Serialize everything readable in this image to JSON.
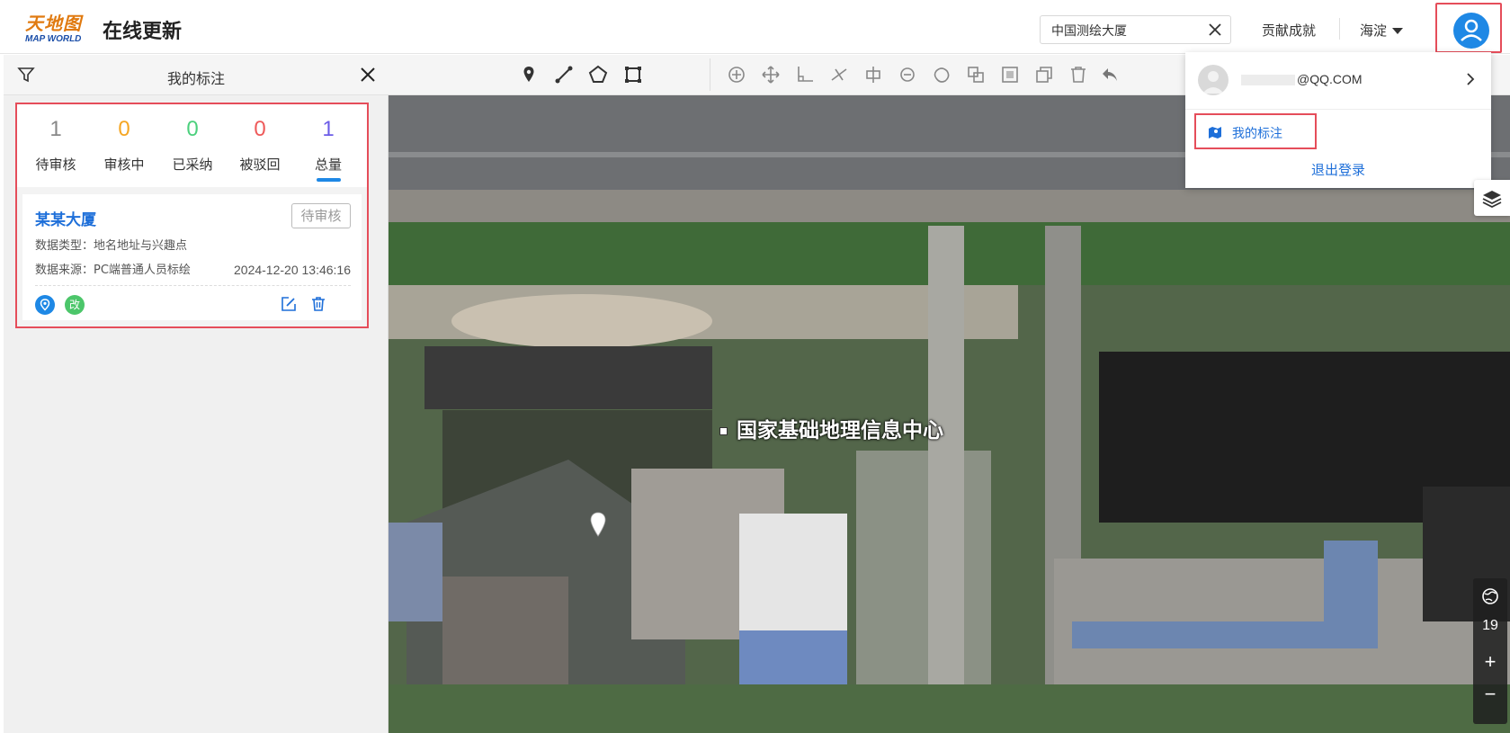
{
  "header": {
    "logo_cn": "天地图",
    "logo_en": "MAP WORLD",
    "title": "在线更新",
    "search_value": "中国测绘大厦",
    "contribution_link": "贡献成就",
    "district": "海淀"
  },
  "panel": {
    "title": "我的标注",
    "stats": [
      {
        "count": "1",
        "label": "待审核",
        "color": "#888888"
      },
      {
        "count": "0",
        "label": "审核中",
        "color": "#f5a623"
      },
      {
        "count": "0",
        "label": "已采纳",
        "color": "#4cd07d"
      },
      {
        "count": "0",
        "label": "被驳回",
        "color": "#ee5a5a"
      },
      {
        "count": "1",
        "label": "总量",
        "color": "#6b5ce7"
      }
    ],
    "card": {
      "title": "某某大厦",
      "status": "待审核",
      "data_type": "数据类型：地名地址与兴趣点",
      "data_source": "数据来源：PC端普通人员标绘",
      "time": "2024-12-20 13:46:16",
      "badge_change": "改"
    }
  },
  "map": {
    "label": "国家基础地理信息中心",
    "zoom_level": "19",
    "zoom_in": "+",
    "zoom_out": "−"
  },
  "dropdown": {
    "email_suffix": "@QQ.COM",
    "my_annotations": "我的标注",
    "logout": "退出登录"
  }
}
